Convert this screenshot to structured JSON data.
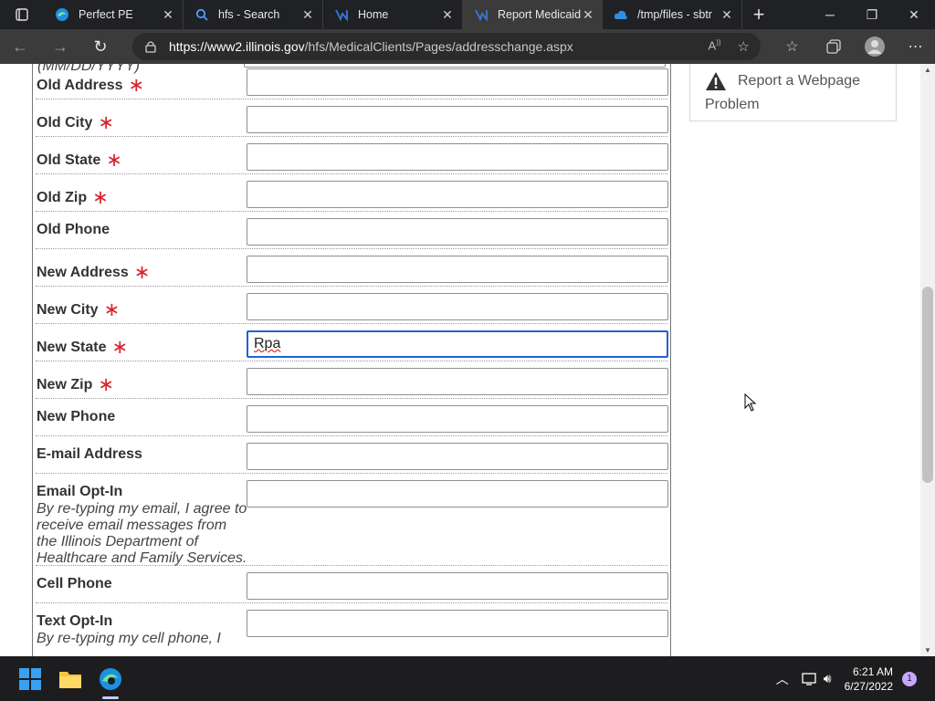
{
  "browser": {
    "tabs": [
      {
        "title": "Perfect PE",
        "icon": "edge-icon"
      },
      {
        "title": "hfs - Search",
        "icon": "search-icon"
      },
      {
        "title": "Home",
        "icon": "hfs-logo-icon"
      },
      {
        "title": "Report Medicaid",
        "icon": "hfs-logo-icon",
        "active": true
      },
      {
        "title": "/tmp/files - sbtr",
        "icon": "cloud-icon"
      }
    ],
    "url_domain": "https://www2.illinois.gov",
    "url_path": "/hfs/MedicalClients/Pages/addresschange.aspx"
  },
  "form": {
    "top_hint": "(MM/DD/YYYY)",
    "rows": [
      {
        "label": "Old Address",
        "required": true,
        "value": ""
      },
      {
        "label": "Old City",
        "required": true,
        "value": ""
      },
      {
        "label": "Old State",
        "required": true,
        "value": ""
      },
      {
        "label": "Old Zip",
        "required": true,
        "value": ""
      },
      {
        "label": "Old Phone",
        "required": false,
        "value": ""
      },
      {
        "label": "New Address",
        "required": true,
        "value": ""
      },
      {
        "label": "New City",
        "required": true,
        "value": ""
      },
      {
        "label": "New State",
        "required": true,
        "value": "Rpa",
        "focused": true
      },
      {
        "label": "New Zip",
        "required": true,
        "value": ""
      },
      {
        "label": "New Phone",
        "required": false,
        "value": ""
      },
      {
        "label": "E-mail Address",
        "required": false,
        "value": ""
      },
      {
        "label": "Email Opt-In",
        "required": false,
        "value": "",
        "hint": "By re-typing my email, I agree to receive email messages from the Illinois Department of Healthcare and Family Services."
      },
      {
        "label": "Cell Phone",
        "required": false,
        "value": ""
      },
      {
        "label": "Text Opt-In",
        "required": false,
        "value": "",
        "hint": "By re-typing my cell phone, I"
      }
    ],
    "required_marker": "∗"
  },
  "sidebar": {
    "report_label": "Report a Webpage Problem"
  },
  "taskbar": {
    "time": "6:21 AM",
    "date": "6/27/2022",
    "notification_count": "1"
  },
  "colors": {
    "required_star": "#d8232a",
    "focus_border": "#1f62d2",
    "chrome_dark": "#202124"
  }
}
